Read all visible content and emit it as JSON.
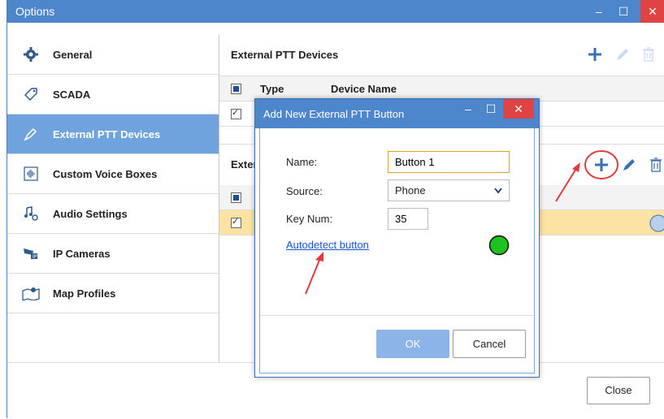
{
  "window": {
    "title": "Options",
    "minimize": "–",
    "maximize": "☐",
    "close": "✕"
  },
  "sidebar": {
    "items": [
      {
        "label": "General",
        "icon": "gear-icon"
      },
      {
        "label": "SCADA",
        "icon": "tag-icon"
      },
      {
        "label": "External PTT Devices",
        "icon": "ptt-icon",
        "selected": true
      },
      {
        "label": "Custom Voice Boxes",
        "icon": "voice-box-icon"
      },
      {
        "label": "Audio Settings",
        "icon": "audio-settings-icon"
      },
      {
        "label": "IP Cameras",
        "icon": "camera-icon"
      },
      {
        "label": "Map Profiles",
        "icon": "map-icon"
      }
    ]
  },
  "devices_section": {
    "title": "External PTT Devices",
    "columns": [
      "Type",
      "Device Name"
    ]
  },
  "buttons_section": {
    "title_partial": "Exter"
  },
  "dialog": {
    "title": "Add New External PTT Button",
    "name_label": "Name:",
    "name_value": "Button 1",
    "source_label": "Source:",
    "source_value": "Phone",
    "keynum_label": "Key Num:",
    "keynum_value": "35",
    "autodetect_link": "Autodetect button",
    "ok_label": "OK",
    "cancel_label": "Cancel",
    "status_color": "#1ec21e"
  },
  "footer": {
    "close_label": "Close"
  },
  "colors": {
    "accent": "#4e86cb",
    "selected": "#6fa3dd",
    "row_highlight": "#fbe3a3",
    "annotation": "#e03b3b"
  }
}
